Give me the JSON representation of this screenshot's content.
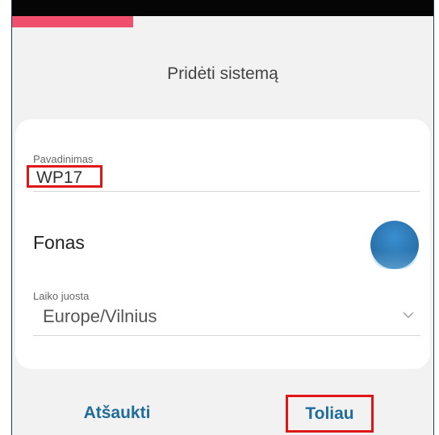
{
  "progress": {
    "fraction": 0.287,
    "color": "#f0506e"
  },
  "page": {
    "title": "Pridėti sistemą"
  },
  "form": {
    "name_label": "Pavadinimas",
    "name_value": "WP17",
    "background_label": "Fonas",
    "background_color": "#2a72ad",
    "timezone_label": "Laiko juosta",
    "timezone_value": "Europe/Vilnius"
  },
  "actions": {
    "cancel_label": "Atšaukti",
    "next_label": "Toliau"
  },
  "icons": {
    "timezone_dropdown": "chevron-down-icon"
  },
  "colors": {
    "accent": "#1f6b99",
    "highlight": "#e01515",
    "background": "#f2f2f2"
  }
}
